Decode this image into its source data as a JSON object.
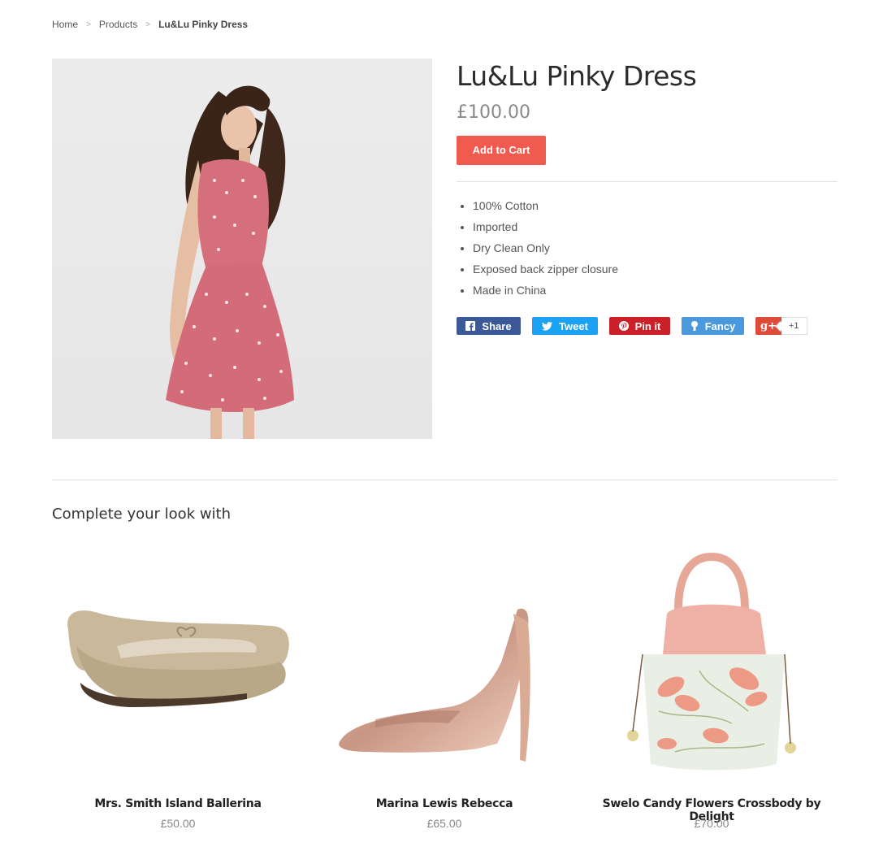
{
  "breadcrumb": {
    "home": "Home",
    "products": "Products",
    "current": "Lu&Lu Pinky Dress",
    "separator": ">"
  },
  "product": {
    "title": "Lu&Lu Pinky Dress",
    "price": "£100.00",
    "add_to_cart": "Add to Cart",
    "features": [
      "100% Cotton",
      "Imported",
      "Dry Clean Only",
      "Exposed back zipper closure",
      "Made in China"
    ]
  },
  "social": {
    "share": "Share",
    "tweet": "Tweet",
    "pin": "Pin it",
    "fancy": "Fancy",
    "gplus_icon": "g+",
    "gplus_count": "+1"
  },
  "related": {
    "title": "Complete your look with",
    "items": [
      {
        "name": "Mrs. Smith Island Ballerina",
        "price": "£50.00",
        "icon": "ballerina-shoe"
      },
      {
        "name": "Marina Lewis Rebecca",
        "price": "£65.00",
        "icon": "high-heel-shoe"
      },
      {
        "name": "Swelo Candy Flowers Crossbody by Delight",
        "price": "£70.00",
        "icon": "floral-bag"
      }
    ]
  },
  "colors": {
    "accent": "#f05a4f",
    "facebook": "#3b5998",
    "twitter": "#1da1f2",
    "pinterest": "#cb2027",
    "fancy": "#4999dc",
    "gplus": "#dd4b39"
  }
}
